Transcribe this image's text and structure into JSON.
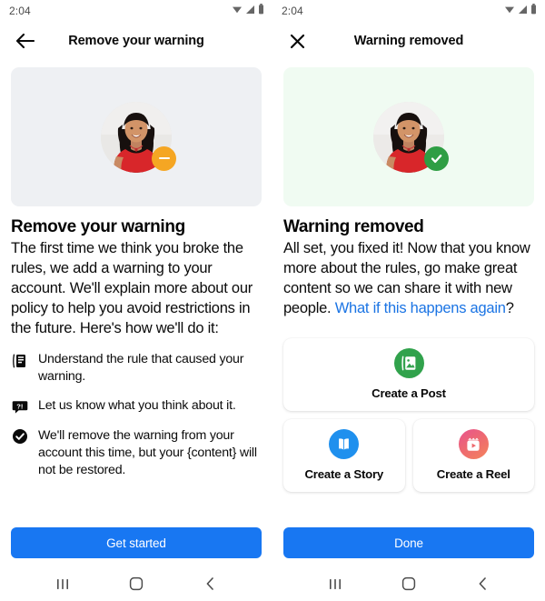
{
  "screens": [
    {
      "id": "remove-warning",
      "status_bar": {
        "time": "2:04",
        "icons": [
          "wifi-icon",
          "signal-icon",
          "battery-icon"
        ]
      },
      "app_bar": {
        "nav_icon": "back-arrow-icon",
        "title": "Remove your warning"
      },
      "hero": {
        "background_color": "#eef0f3",
        "avatar_name": "avatar",
        "badge_icon": "minus-badge-icon",
        "badge_color": "#f5a623"
      },
      "headline": "Remove your warning",
      "paragraph": "The first time we think you broke the rules, we add a warning to your account. We'll explain more about our policy to help you avoid restrictions in the future. Here's how we'll do it:",
      "bullets": [
        {
          "icon": "rulebook-icon",
          "text": "Understand the rule that caused your warning."
        },
        {
          "icon": "question-bubble-icon",
          "text": "Let us know what you think about it."
        },
        {
          "icon": "check-circle-icon",
          "text": "We'll remove the warning from your account this time, but your {content} will not be restored."
        }
      ],
      "cta_label": "Get started",
      "cta_color": "#1877f2",
      "sys_nav": [
        "recents-icon",
        "home-icon",
        "back-icon"
      ]
    },
    {
      "id": "warning-removed",
      "status_bar": {
        "time": "2:04",
        "icons": [
          "wifi-icon",
          "signal-icon",
          "battery-icon"
        ]
      },
      "app_bar": {
        "nav_icon": "close-icon",
        "title": "Warning removed"
      },
      "hero": {
        "background_color": "#f0fbf2",
        "avatar_name": "avatar",
        "badge_icon": "check-badge-icon",
        "badge_color": "#2f9e44"
      },
      "headline": "Warning removed",
      "paragraph_before_link": "All set, you fixed it! Now that you know more about the rules, go make great content so we can share it with new people. ",
      "link_text": "What if this happens again",
      "paragraph_after_link": "?",
      "link_color": "#1b74e4",
      "cards": [
        {
          "icon": "create-post-icon",
          "label": "Create a Post",
          "color": "#31a24c"
        },
        {
          "icon": "create-story-icon",
          "label": "Create a Story",
          "color": "#1f90ee"
        },
        {
          "icon": "create-reel-icon",
          "label": "Create a Reel",
          "color": "#ee6a6f"
        }
      ],
      "cta_label": "Done",
      "cta_color": "#1877f2",
      "sys_nav": [
        "recents-icon",
        "home-icon",
        "back-icon"
      ]
    }
  ]
}
